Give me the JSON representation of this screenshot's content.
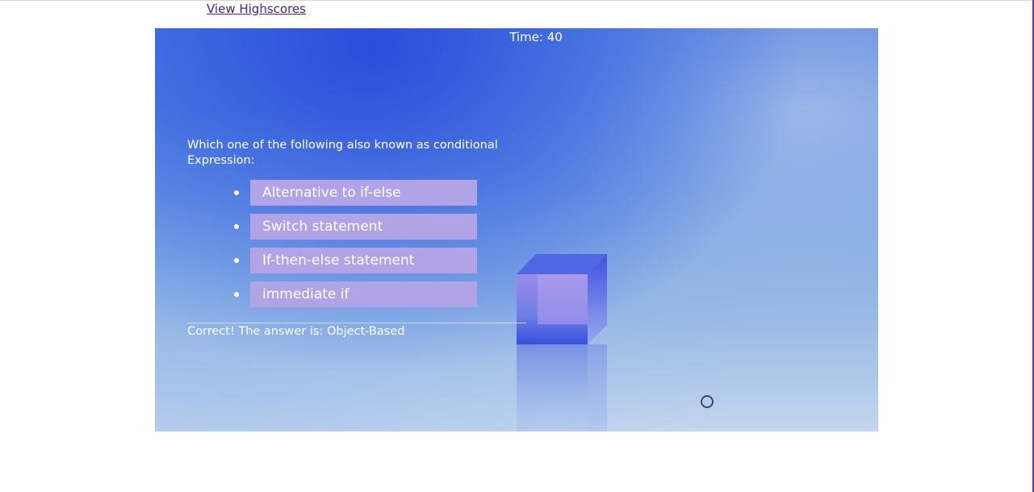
{
  "header": {
    "highscores_link": "View Highscores"
  },
  "quiz": {
    "timer": "Time: 40",
    "question": "Which one of the following also known as conditional Expression:",
    "choices": [
      "Alternative to if-else",
      "Switch statement",
      "If-then-else statement",
      "immediate if"
    ],
    "feedback": "Correct! The answer is: Object-Based"
  },
  "colors": {
    "link": "#4b1e82",
    "choice_bg": "#b0a4e6",
    "panel_top": "#2c50dc",
    "panel_bottom": "#c5d6ee"
  },
  "icons": {
    "bullet": "bullet-dot-icon",
    "marker": "circle-icon"
  }
}
